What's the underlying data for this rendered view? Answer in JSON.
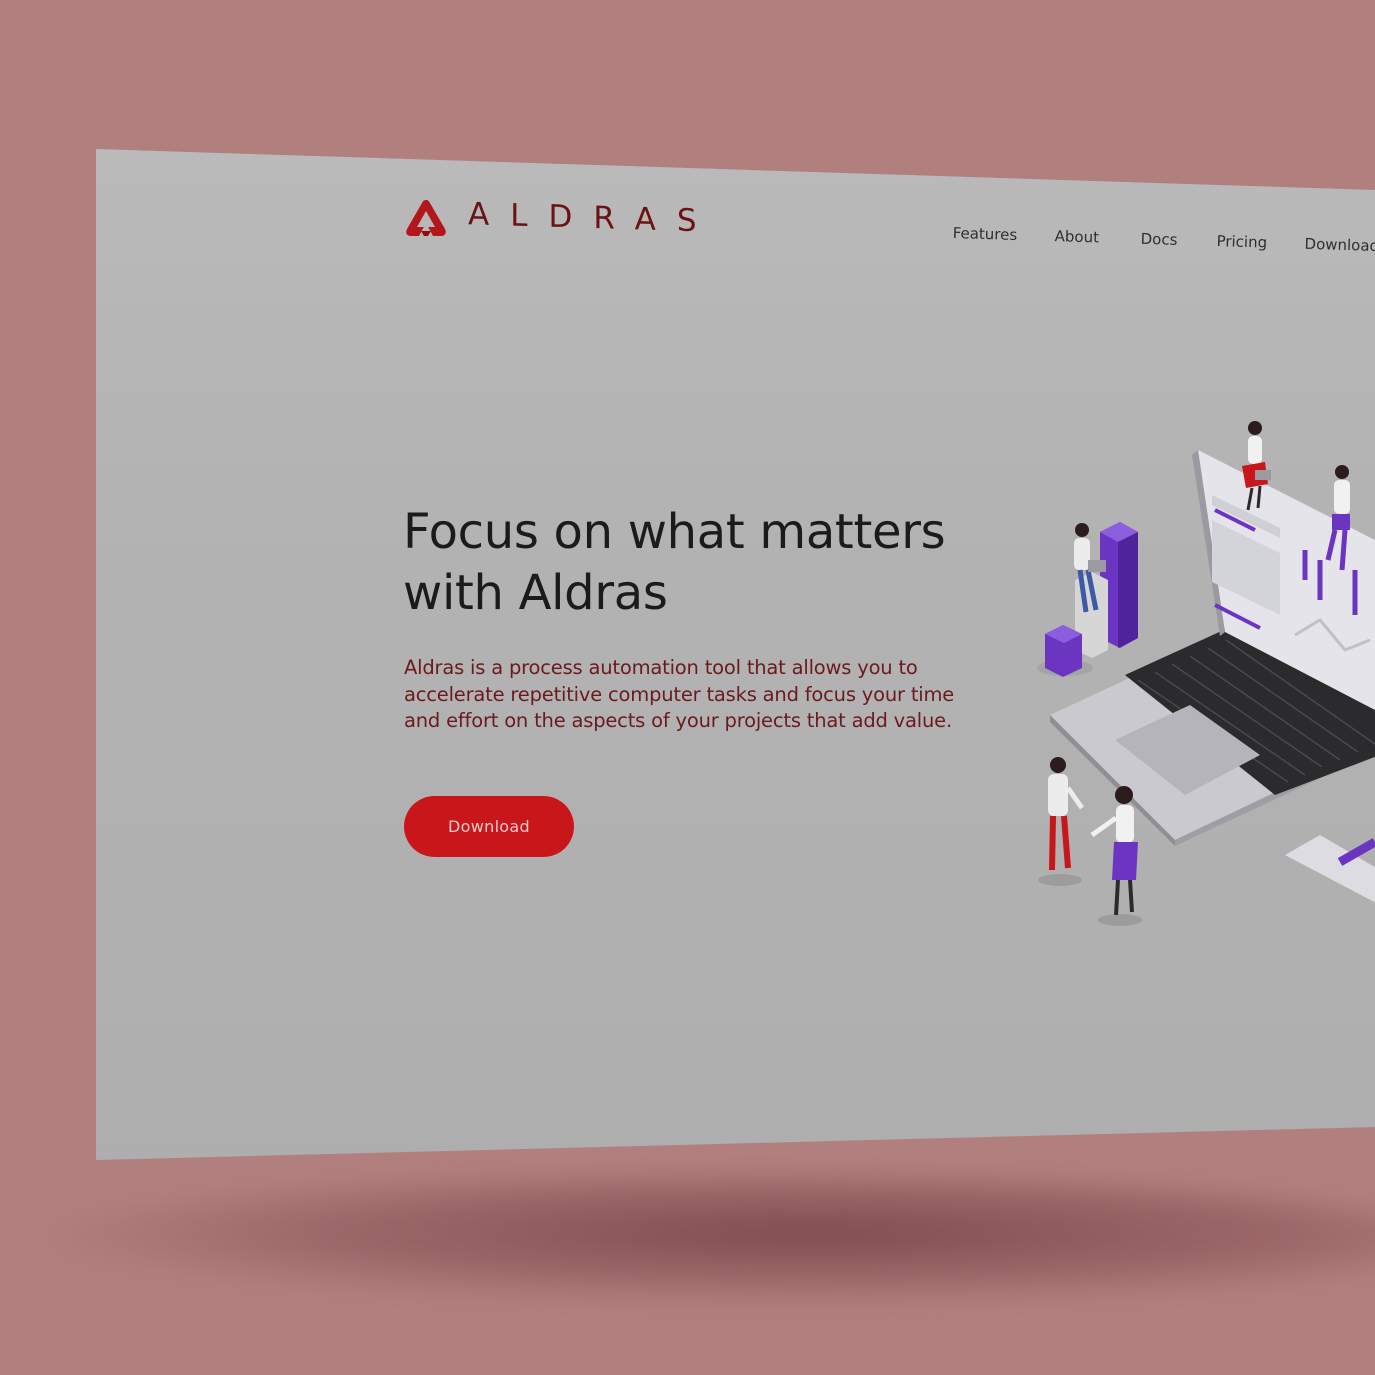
{
  "brand": {
    "name": "ALDRAS",
    "accent_color": "#c8161b",
    "logo_icon": "aldras-logo-icon"
  },
  "nav": {
    "items": [
      {
        "label": "Features"
      },
      {
        "label": "About"
      },
      {
        "label": "Docs"
      },
      {
        "label": "Pricing"
      },
      {
        "label": "Download"
      }
    ]
  },
  "hero": {
    "title": "Focus on what matters with Aldras",
    "description": "Aldras is a process automation tool that allows you to accelerate repetitive computer tasks and focus your time and effort on the aspects of your projects that add value.",
    "button_label": "Download",
    "illustration_icon": "isometric-laptop-team-illustration"
  },
  "colors": {
    "background": "#b27f7f",
    "screen": "#b3b3b3",
    "illustration_accent": "#6b35c2"
  }
}
